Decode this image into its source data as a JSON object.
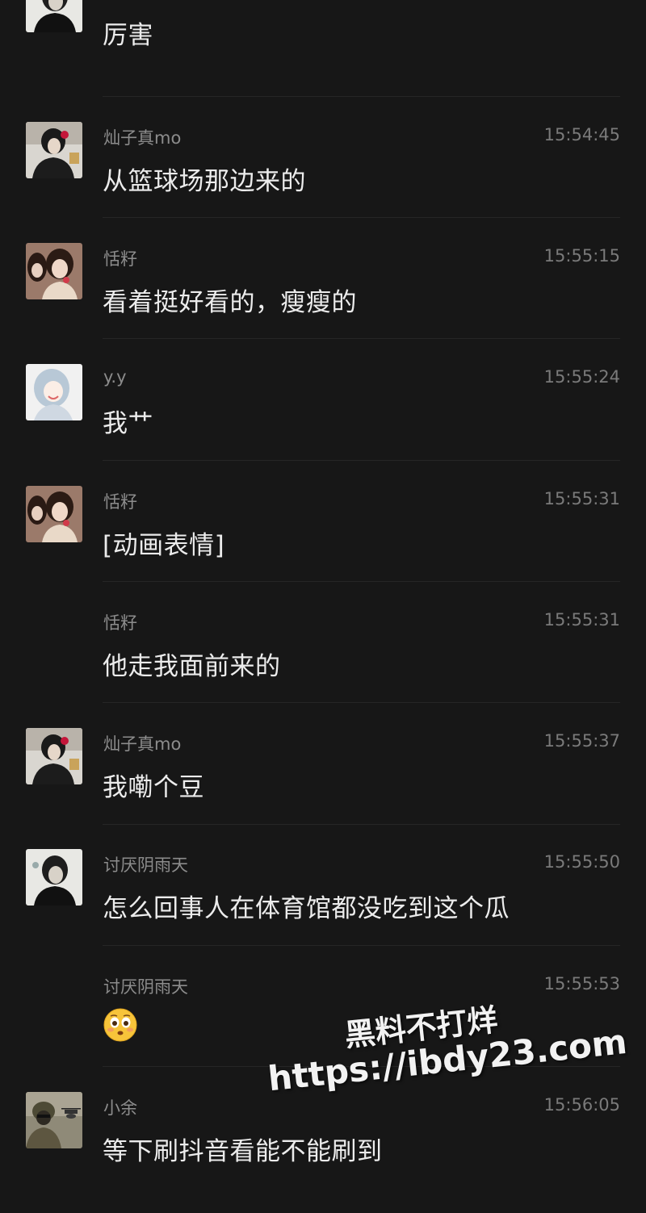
{
  "messages": [
    {
      "name": "",
      "time": "",
      "text": "厉害",
      "avatar": "boy-dark-hair-avatar"
    },
    {
      "name": "灿子真mo",
      "time": "15:54:45",
      "text": "从篮球场那边来的",
      "avatar": "girl-red-flower-avatar"
    },
    {
      "name": "恬籽",
      "time": "15:55:15",
      "text": "看着挺好看的，瘦瘦的",
      "avatar": "two-girls-avatar"
    },
    {
      "name": "y.y",
      "time": "15:55:24",
      "text": "我艹",
      "avatar": "anime-girl-avatar"
    },
    {
      "name": "恬籽",
      "time": "15:55:31",
      "text": "[动画表情]",
      "avatar": "two-girls-avatar"
    },
    {
      "name": "恬籽",
      "time": "15:55:31",
      "text": "他走我面前来的",
      "avatar": ""
    },
    {
      "name": "灿子真mo",
      "time": "15:55:37",
      "text": "我嘞个豆",
      "avatar": "girl-red-flower-avatar"
    },
    {
      "name": "讨厌阴雨天",
      "time": "15:55:50",
      "text": "怎么回事人在体育馆都没吃到这个瓜",
      "avatar": "boy-dark-hair-avatar"
    },
    {
      "name": "讨厌阴雨天",
      "time": "15:55:53",
      "text": "",
      "emoji": "flushed-face-emoji",
      "avatar": ""
    },
    {
      "name": "小余",
      "time": "15:56:05",
      "text": "等下刷抖音看能不能刷到",
      "avatar": "soldier-helicopter-avatar"
    }
  ],
  "watermark": {
    "line1": "黑料不打烊",
    "line2": "https://ibdy23.com"
  },
  "colors": {
    "background": "#171717",
    "name": "#8c8c8c",
    "time": "#7a7a7a",
    "text": "#ececec",
    "divider": "#262626"
  }
}
